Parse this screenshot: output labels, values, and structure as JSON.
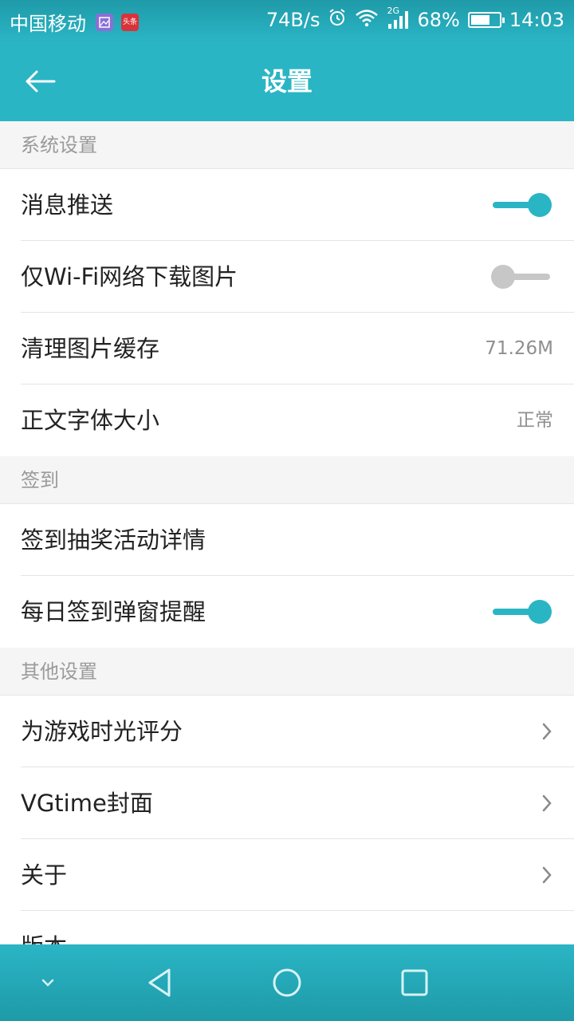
{
  "status_bar": {
    "carrier": "中国移动",
    "app_icon_text": "头条",
    "speed": "74B/s",
    "network_label": "2G",
    "battery": "68%",
    "battery_level": 0.68,
    "time": "14:03"
  },
  "app_bar": {
    "title": "设置",
    "back_icon": "arrow-left-icon"
  },
  "sections": [
    {
      "header": "系统设置",
      "rows": [
        {
          "label": "消息推送",
          "type": "toggle",
          "on": true
        },
        {
          "label": "仅Wi-Fi网络下载图片",
          "type": "toggle",
          "on": false
        },
        {
          "label": "清理图片缓存",
          "type": "value",
          "value": "71.26M"
        },
        {
          "label": "正文字体大小",
          "type": "value",
          "value": "正常"
        }
      ]
    },
    {
      "header": "签到",
      "rows": [
        {
          "label": "签到抽奖活动详情",
          "type": "plain"
        },
        {
          "label": "每日签到弹窗提醒",
          "type": "toggle",
          "on": true
        }
      ]
    },
    {
      "header": "其他设置",
      "rows": [
        {
          "label": "为游戏时光评分",
          "type": "chevron"
        },
        {
          "label": "VGtime封面",
          "type": "chevron"
        },
        {
          "label": "关于",
          "type": "chevron"
        },
        {
          "label": "版本",
          "type": "plain"
        }
      ]
    }
  ],
  "nav_bar": {
    "icons": [
      "chevron-down-icon",
      "back-triangle-icon",
      "home-circle-icon",
      "recents-square-icon"
    ]
  },
  "colors": {
    "accent": "#2ab5c5",
    "toggle_off": "#c7c7c7",
    "section_bg": "#f5f5f5"
  }
}
